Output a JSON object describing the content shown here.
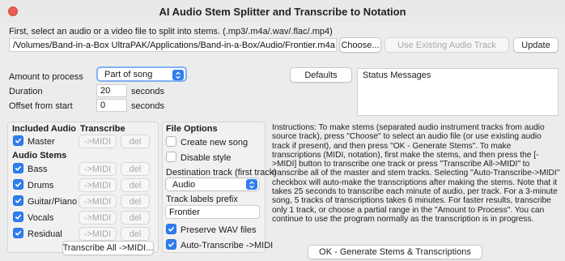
{
  "window": {
    "title": "AI Audio Stem Splitter and Transcribe to Notation"
  },
  "top": {
    "instruction": "First, select an audio or a video file to split into stems. (.mp3/.m4a/.wav/.flac/.mp4)",
    "file_path": "/Volumes/Band-in-a-Box UltraPAK/Applications/Band-in-a-Box/Audio/Frontier.m4a",
    "choose_label": "Choose...",
    "use_existing_label": "Use Existing Audio Track",
    "update_label": "Update"
  },
  "process": {
    "amount_label": "Amount to process",
    "amount_value": "Part of song",
    "duration_label": "Duration",
    "duration_value": "20",
    "duration_unit": "seconds",
    "offset_label": "Offset from start",
    "offset_value": "0",
    "offset_unit": "seconds"
  },
  "defaults_label": "Defaults",
  "status_messages_label": "Status Messages",
  "stems": {
    "included_audio_header": "Included Audio",
    "transcribe_header": "Transcribe",
    "audio_stems_header": "Audio Stems",
    "midi_label": "->MIDI",
    "del_label": "del",
    "master_label": "Master",
    "items": [
      {
        "label": "Bass"
      },
      {
        "label": "Drums"
      },
      {
        "label": "Guitar/Piano"
      },
      {
        "label": "Vocals"
      },
      {
        "label": "Residual"
      }
    ],
    "transcribe_all_label": "Transcribe All ->MIDI..."
  },
  "file_options": {
    "header": "File Options",
    "create_new_song": "Create new song",
    "disable_style": "Disable style",
    "destination_label": "Destination track (first track)",
    "destination_value": "Audio",
    "track_prefix_label": "Track labels prefix",
    "track_prefix_value": "Frontier",
    "preserve_wav": "Preserve WAV files",
    "auto_transcribe": "Auto-Transcribe ->MIDI"
  },
  "instructions_text": "Instructions: To make stems (separated audio instrument tracks from audio source track), press \"Choose\" to select an audio file (or use existing audio track if present), and then press \"OK - Generate Stems\". To make transcriptions (MIDI, notation), first make the stems, and then press the [->MIDI] button to transcribe one track or press \"Transcribe All->MIDI\" to transcribe all of the master and stem tracks. Selecting \"Auto-Transcribe->MIDI\" checkbox will auto-make the transcriptions after making the stems. Note that it takes 25 seconds to transcribe each minute of audio, per track. For a 3-minute song, 5 tracks of transcriptions takes 6 minutes. For faster results, transcribe only 1 track, or choose a partial range in the \"Amount to Process\". You can continue to use the program normally as the transcription is in progress.",
  "ok_button_label": "OK - Generate Stems & Transcriptions",
  "colors": {
    "accent": "#2f7ef0",
    "close": "#ee5d55"
  }
}
